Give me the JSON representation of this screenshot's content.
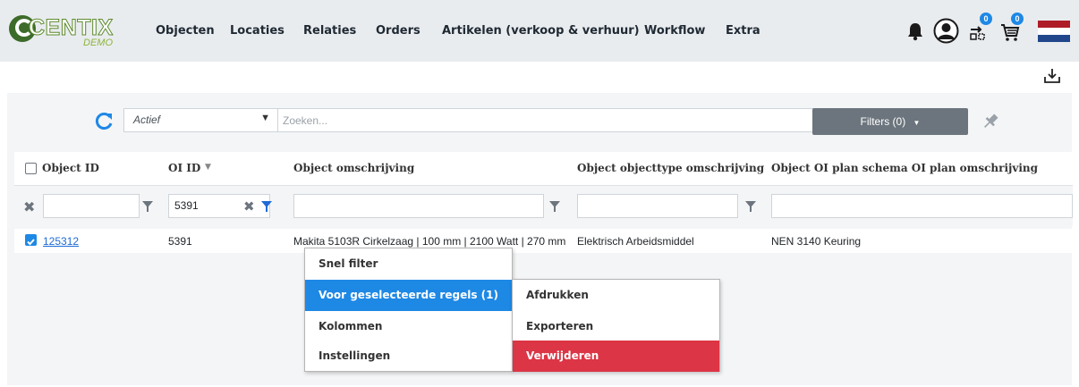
{
  "brand": {
    "name": "CENTIX",
    "sub": "DEMO"
  },
  "nav": {
    "items": [
      {
        "label": "Objecten"
      },
      {
        "label": "Locaties"
      },
      {
        "label": "Relaties"
      },
      {
        "label": "Orders"
      },
      {
        "label": "Artikelen (verkoop & verhuur)"
      },
      {
        "label": "Workflow"
      },
      {
        "label": "Extra"
      }
    ],
    "icons": [
      "bell-icon",
      "user-avatar-icon",
      "scan-list-icon",
      "cart-icon",
      "language-flag-nl"
    ],
    "scan_badge": "0",
    "cart_badge": "0"
  },
  "toolbar": {
    "status_value": "Actief",
    "search_placeholder": "Zoeken...",
    "filters_label": "Filters (0)"
  },
  "table": {
    "headers": [
      "Object ID",
      "OI ID",
      "Object omschrijving",
      "Object objecttype omschrijving",
      "Object OI plan schema OI plan omschrijving"
    ],
    "filter_oi_id": "5391",
    "rows": [
      {
        "object_id": "125312",
        "oi_id": "5391",
        "omschrijving": "Makita 5103R Cirkelzaag | 100 mm | 2100 Watt | 270 mm",
        "objecttype": "Elektrisch Arbeidsmiddel",
        "plan": "NEN 3140 Keuring"
      }
    ]
  },
  "context_menu": {
    "items": [
      "Snel filter",
      "Voor geselecteerde regels (1)",
      "Kolommen",
      "Instellingen"
    ],
    "submenu": [
      "Afdrukken",
      "Exporteren",
      "Verwijderen"
    ]
  },
  "colors": {
    "navbar_bg": "#e9ecef",
    "accent": "#1e88e5",
    "danger": "#dc3545",
    "filters_btn": "#6c757d",
    "logo_green": "#5c8a2c"
  }
}
